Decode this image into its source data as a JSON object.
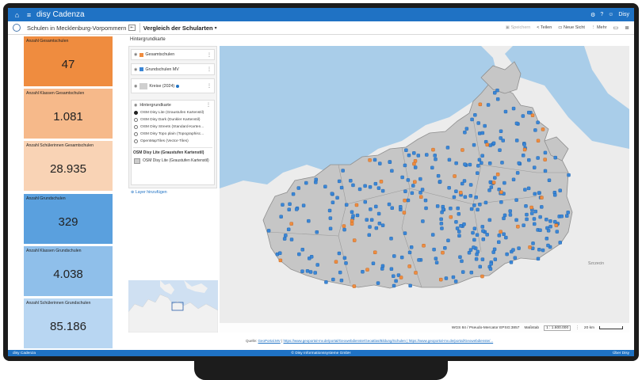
{
  "app": {
    "title": "disy Cadenza",
    "user": "Disy"
  },
  "toolbar": {
    "context": "Schulen in Mecklenburg-Vorpommern",
    "view_title": "Vergleich der Schularten",
    "actions": {
      "save": "Speichern",
      "share": "Teilen",
      "new_view": "Neue Sicht",
      "more": "Mehr"
    }
  },
  "kpis": [
    {
      "label": "Anzahl Gesamtschulen",
      "value": "47",
      "color": "#ef8c3f"
    },
    {
      "label": "Anzahl Klassen Gesamtschulen",
      "value": "1.081",
      "color": "#f6b98a"
    },
    {
      "label": "Anzahl Schülerinnen Gesamtschulen",
      "value": "28.935",
      "color": "#f9d3b5"
    },
    {
      "label": "Anzahl Grundschulen",
      "value": "329",
      "color": "#5aa0de"
    },
    {
      "label": "Anzahl Klassen Grundschulen",
      "value": "4.038",
      "color": "#8fbfea"
    },
    {
      "label": "Anzahl Schülerinnen Grundschulen",
      "value": "85.186",
      "color": "#b8d6f2"
    }
  ],
  "content_title": "Hintergrundkarte",
  "layers": [
    {
      "label": "Gesamtschulen",
      "color": "#ef8c3f"
    },
    {
      "label": "Grundschulen MV",
      "color": "#3a86d6"
    },
    {
      "label": "Kreise (2024)",
      "color": "#cfcfcf"
    }
  ],
  "basemap": {
    "title": "Hintergrundkarte",
    "options": [
      {
        "label": "OSM Disy Lite (Graustufen Kartenstil)",
        "selected": true
      },
      {
        "label": "OSM Disy Dark (Dunkler Kartenstil)",
        "selected": false
      },
      {
        "label": "OSM Disy Streets (Standard-Karten...",
        "selected": false
      },
      {
        "label": "OSM Disy Topo plain (Topographisc...",
        "selected": false
      },
      {
        "label": "OpenMapTiles (Vector-Tiles)",
        "selected": false
      }
    ],
    "active_title": "OSM Disy Lite (Graustufen Kartenstil)",
    "active_label": "OSM Disy Lite (Graustufen Kartenstil)"
  },
  "add_layer": "Layer hinzufügen",
  "map": {
    "crs": "WGS 84 / Pseudo-Mercator EPSG:3857",
    "scale_label": "Maßstab",
    "scale_value": "1 : 1.600.000",
    "scalebar": "20 km",
    "place_label": "Szczecin"
  },
  "source": {
    "prefix": "Quelle:",
    "link1": "GeoPortal.MV",
    "link2": "https://www.geoportal-mv.de/portal/Geowebdienste/Geoatlas/Bildung/Schulen | https://www.geoportal-mv.de/portal/Geowebdienste/..."
  },
  "footer": {
    "left": "disy Cadenza",
    "center": "© Disy Informationssysteme GmbH",
    "right": "Über Disy"
  }
}
